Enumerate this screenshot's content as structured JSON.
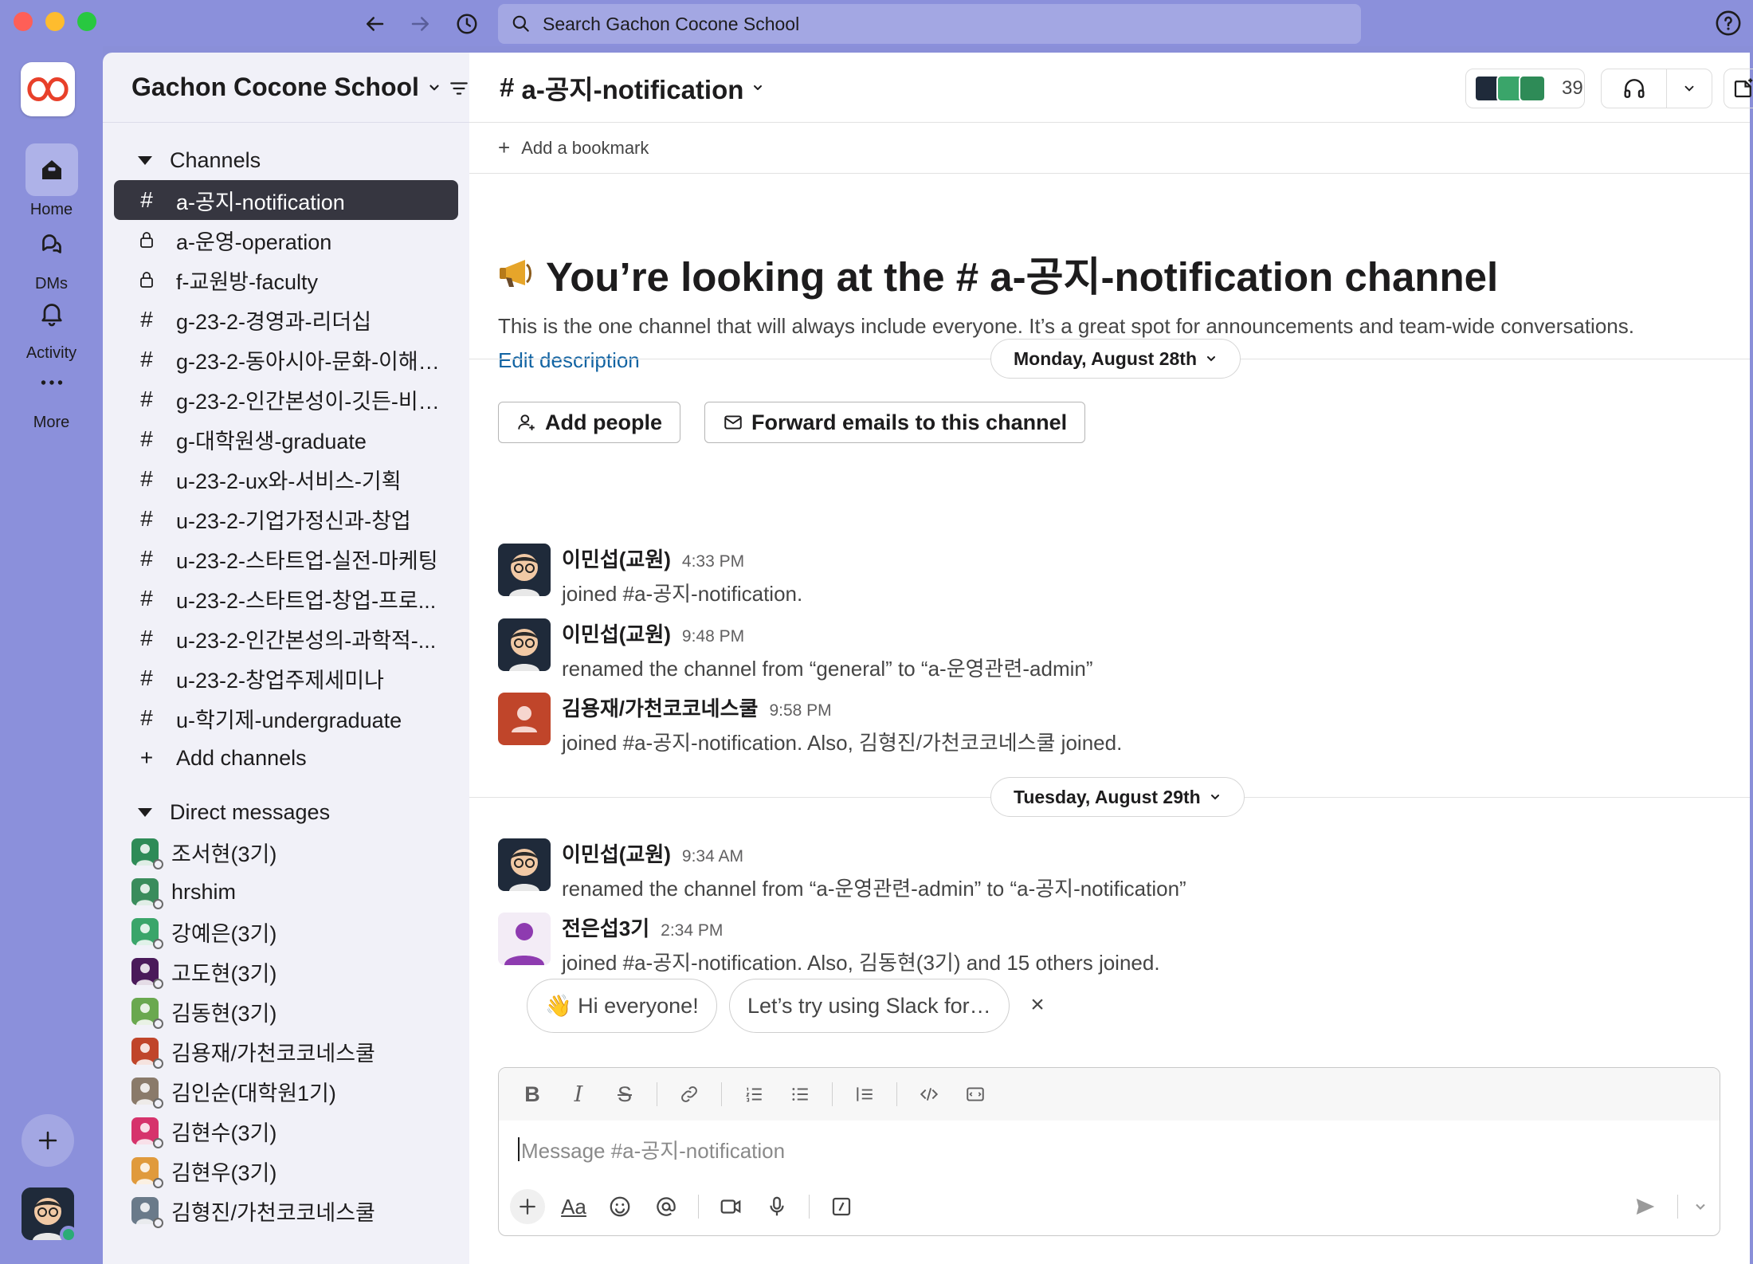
{
  "titlebar": {
    "search_placeholder": "Search Gachon Cocone School"
  },
  "rail": {
    "items": [
      {
        "label": "Home",
        "icon": "home-icon",
        "active": true
      },
      {
        "label": "DMs",
        "icon": "dms-icon",
        "active": false
      },
      {
        "label": "Activity",
        "icon": "bell-icon",
        "active": false
      },
      {
        "label": "More",
        "icon": "more-icon",
        "active": false
      }
    ]
  },
  "sidebar": {
    "workspace_name": "Gachon Cocone School",
    "channels_header": "Channels",
    "channels": [
      {
        "label": "a-공지-notification",
        "type": "public",
        "active": true
      },
      {
        "label": "a-운영-operation",
        "type": "private",
        "active": false
      },
      {
        "label": "f-교원방-faculty",
        "type": "private",
        "active": false
      },
      {
        "label": "g-23-2-경영과-리더십",
        "type": "public",
        "active": false
      },
      {
        "label": "g-23-2-동아시아-문화-이해와...",
        "type": "public",
        "active": false
      },
      {
        "label": "g-23-2-인간본성이-깃든-비즈...",
        "type": "public",
        "active": false
      },
      {
        "label": "g-대학원생-graduate",
        "type": "public",
        "active": false
      },
      {
        "label": "u-23-2-ux와-서비스-기획",
        "type": "public",
        "active": false
      },
      {
        "label": "u-23-2-기업가정신과-창업",
        "type": "public",
        "active": false
      },
      {
        "label": "u-23-2-스타트업-실전-마케팅",
        "type": "public",
        "active": false
      },
      {
        "label": "u-23-2-스타트업-창업-프로...",
        "type": "public",
        "active": false
      },
      {
        "label": "u-23-2-인간본성의-과학적-...",
        "type": "public",
        "active": false
      },
      {
        "label": "u-23-2-창업주제세미나",
        "type": "public",
        "active": false
      },
      {
        "label": "u-학기제-undergraduate",
        "type": "public",
        "active": false
      }
    ],
    "add_channels": "Add channels",
    "dm_header": "Direct messages",
    "dms": [
      {
        "label": "조서현(3기)",
        "color": "#2e8b57"
      },
      {
        "label": "hrshim",
        "color": "#3a8c5c"
      },
      {
        "label": "강예은(3기)",
        "color": "#3aa56a"
      },
      {
        "label": "고도현(3기)",
        "color": "#4a1a5a"
      },
      {
        "label": "김동현(3기)",
        "color": "#6aa84f"
      },
      {
        "label": "김용재/가천코코네스쿨",
        "color": "#c0452a"
      },
      {
        "label": "김인순(대학원1기)",
        "color": "#8a7a6a"
      },
      {
        "label": "김현수(3기)",
        "color": "#d6336c"
      },
      {
        "label": "김현우(3기)",
        "color": "#e09a3c"
      },
      {
        "label": "김형진/가천코코네스쿨",
        "color": "#6a7a8a"
      }
    ]
  },
  "channel": {
    "name": "a-공지-notification",
    "member_count": "39",
    "add_bookmark": "Add a bookmark",
    "intro_title": "You’re looking at the # a-공지-notification channel",
    "intro_desc": "This is the one channel that will always include everyone. It’s a great spot for announcements and team-wide conversations.",
    "edit_description": "Edit description",
    "add_people": "Add people",
    "forward_emails": "Forward emails to this channel"
  },
  "dates": [
    "Monday, August 28th",
    "Tuesday, August 29th"
  ],
  "messages": [
    {
      "author": "이민섭(교원)",
      "time": "4:33 PM",
      "text": "joined #a-공지-notification."
    },
    {
      "author": "이민섭(교원)",
      "time": "9:48 PM",
      "text": "renamed the channel from “general” to “a-운영관련-admin”"
    },
    {
      "author": "김용재/가천코코네스쿨",
      "time": "9:58 PM",
      "text": "joined #a-공지-notification. Also, 김형진/가천코코네스쿨 joined."
    },
    {
      "author": "이민섭(교원)",
      "time": "9:34 AM",
      "text": "renamed the channel from “a-운영관련-admin” to “a-공지-notification”"
    },
    {
      "author": "전은섭3기",
      "time": "2:34 PM",
      "text": "joined #a-공지-notification. Also, 김동현(3기) and 15 others joined."
    }
  ],
  "suggestions": [
    "👋 Hi everyone!",
    "Let’s try using Slack for…"
  ],
  "composer": {
    "placeholder": "Message #a-공지-notification"
  },
  "colors": {
    "accent": "#8b90db",
    "active_channel_bg": "#363640",
    "link": "#1264a3"
  }
}
